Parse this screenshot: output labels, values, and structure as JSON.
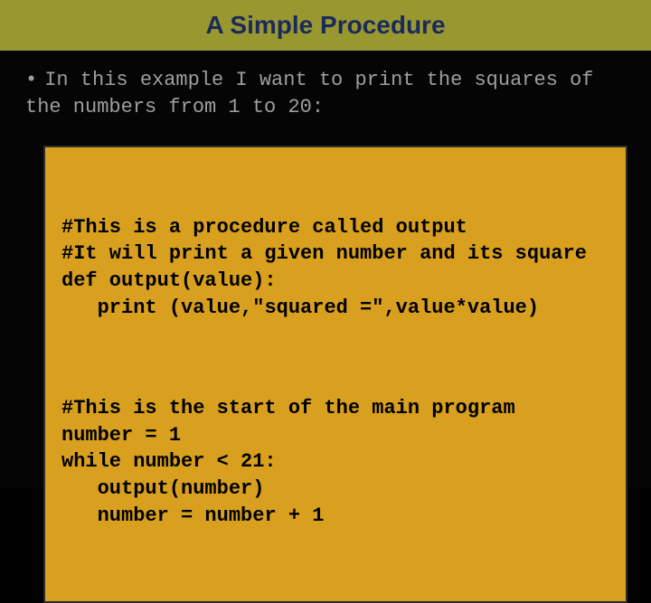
{
  "title": "A Simple Procedure",
  "intro_bullet": "•",
  "intro_text": "In this example I want to print the squares of the numbers from 1 to 20:",
  "code": {
    "block1": "#This is a procedure called output\n#It will print a given number and its square\ndef output(value):\n   print (value,\"squared =\",value*value)",
    "block2": "#This is the start of the main program\nnumber = 1\nwhile number < 21:\n   output(number)\n   number = number + 1"
  }
}
